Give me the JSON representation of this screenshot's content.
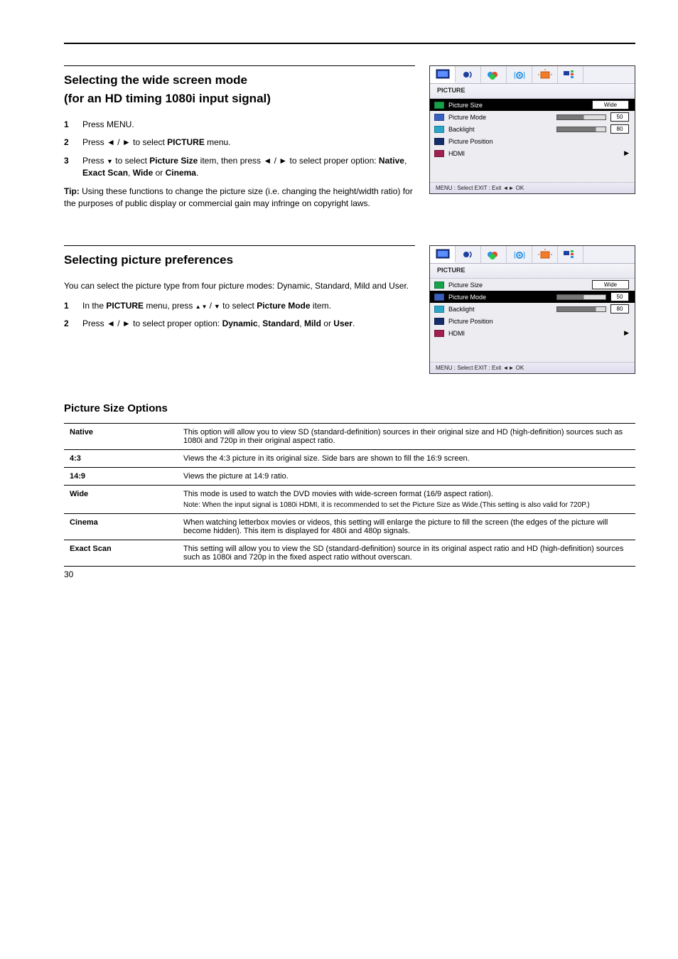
{
  "page_number": "30",
  "section1": {
    "title_a": "Selecting the wide screen mode",
    "title_b": "(for an HD timing 1080i input signal)",
    "steps": [
      {
        "n": "1",
        "html": "Press MENU."
      },
      {
        "n": "2",
        "html": "Press <b>◄</b> / <b>►</b> to select <b>PICTURE</b> menu."
      },
      {
        "n": "3",
        "html": "Press <span class='triangle-down'></span> to select <b>Picture Size</b> item, then press <b>◄</b> / <b>►</b> to select proper option: <b>Native</b>, <b>Exact Scan</b>, <b>Wide</b> or <b>Cinema</b>."
      }
    ],
    "tip_label": "Tip:",
    "tip_text": "Using these functions to change the picture size (i.e. changing the height/width ratio) for the purposes of public display or commercial gain may infringe on copyright laws.",
    "menu": {
      "title": "PICTURE",
      "rows": [
        {
          "icon": "green",
          "label": "Picture Size",
          "kind": "box",
          "value": "Wide"
        },
        {
          "icon": "blue",
          "label": "Picture Mode",
          "kind": "slider",
          "pct": 55,
          "box": "50"
        },
        {
          "icon": "teal",
          "label": "Backlight",
          "kind": "slider",
          "pct": 80,
          "box": "80"
        },
        {
          "icon": "navy",
          "label": "Picture Position",
          "kind": "plain"
        },
        {
          "icon": "red",
          "label": "HDMI",
          "kind": "arrow"
        }
      ],
      "hint": "MENU : Select    EXIT : Exit    ◄►    OK",
      "selected_index": 0
    }
  },
  "section2": {
    "title_a": "Selecting picture preferences",
    "title_b": "",
    "intro": "You can select the picture type from four picture modes: Dynamic, Standard, Mild and User.",
    "steps": [
      {
        "n": "1",
        "html": "In the <b>PICTURE</b> menu, press <span class='triangle-pair'><span class='triangle-ud'></span><span class='sep'>/</span><span class='triangle-down'></span></span> to select <b>Picture Mode</b> item."
      },
      {
        "n": "2",
        "html": "Press <b>◄</b> / <b>►</b> to select proper option: <b>Dynamic</b>, <b>Standard</b>, <b>Mild</b> or <b>User</b>."
      }
    ],
    "menu": {
      "title": "PICTURE",
      "rows": [
        {
          "icon": "green",
          "label": "Picture Size",
          "kind": "box",
          "value": "Wide"
        },
        {
          "icon": "blue",
          "label": "Picture Mode",
          "kind": "slider",
          "pct": 55,
          "box": "50"
        },
        {
          "icon": "teal",
          "label": "Backlight",
          "kind": "slider",
          "pct": 80,
          "box": "80"
        },
        {
          "icon": "navy",
          "label": "Picture Position",
          "kind": "plain"
        },
        {
          "icon": "red",
          "label": "HDMI",
          "kind": "arrow"
        }
      ],
      "hint": "MENU : Select    EXIT : Exit    ◄►    OK",
      "selected_index": 1
    }
  },
  "options_heading": "Picture Size Options",
  "options": [
    {
      "name": "Native",
      "desc": "This option will allow you to view SD (standard-definition) sources in their original size and HD (high-definition) sources such as 1080i and 720p in their original aspect ratio."
    },
    {
      "name": "4:3",
      "desc": "Views the 4:3 picture in its original size. Side bars are shown to fill the 16:9 screen."
    },
    {
      "name": "14:9",
      "desc": "Views the picture at 14:9 ratio."
    },
    {
      "name": "Wide",
      "desc": "This mode is used to watch the DVD movies with wide-screen format (16/9 aspect ration).",
      "note": "Note: When the input signal is 1080i HDMI, it is recommended to set the Picture Size as Wide.(This setting is also valid for 720P.)"
    },
    {
      "name": "Cinema",
      "desc": "When watching letterbox movies or videos, this setting will enlarge the picture to fill the screen (the edges of the picture will become hidden). This item is displayed for 480i and 480p signals."
    },
    {
      "name": "Exact Scan",
      "desc": "This setting will allow you to view the SD (standard-definition) source in its original aspect ratio and HD (high-definition) sources such as 1080i and 720p in the fixed aspect ratio without overscan."
    }
  ],
  "icons": [
    "picture",
    "sound",
    "colour",
    "channel",
    "setup",
    "app"
  ]
}
